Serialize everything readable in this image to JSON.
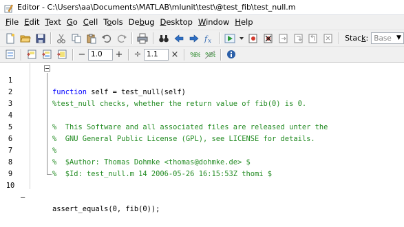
{
  "window": {
    "title": "Editor - C:\\Users\\aa\\Documents\\MATLAB\\mlunit\\test\\@test_fib\\test_null.m"
  },
  "menu": [
    {
      "mn": "F",
      "rest": "ile"
    },
    {
      "mn": "E",
      "rest": "dit"
    },
    {
      "mn": "T",
      "rest": "ext"
    },
    {
      "mn": "G",
      "rest": "o"
    },
    {
      "mn": "C",
      "rest": "ell"
    },
    {
      "pre": "T",
      "mn": "o",
      "rest": "ols"
    },
    {
      "pre": "De",
      "mn": "b",
      "rest": "ug"
    },
    {
      "mn": "D",
      "rest": "esktop"
    },
    {
      "mn": "W",
      "rest": "indow"
    },
    {
      "mn": "H",
      "rest": "elp"
    }
  ],
  "toolbar": {
    "stack_label_pre": "Stac",
    "stack_label_mn": "k",
    "stack_label_post": ":",
    "stack_value": "Base",
    "cell_minus": "−",
    "cell_value_1": "1.0",
    "cell_plus": "+",
    "cell_div": "÷",
    "cell_value_2": "1.1",
    "cell_times": "×"
  },
  "colors": {
    "keyword": "#0000ff",
    "comment": "#228b22",
    "text": "#000000"
  },
  "code": {
    "lines": [
      {
        "n": "1",
        "dash": "",
        "kw": "function",
        "text": " self = test_null(self)",
        "type": "func"
      },
      {
        "n": "2",
        "dash": "",
        "text": "%test_null checks, whether the return value of fib(0) is 0.",
        "type": "comment"
      },
      {
        "n": "3",
        "dash": "",
        "text": "",
        "type": "blank"
      },
      {
        "n": "4",
        "dash": "",
        "text": "%  This Software and all associated files are released unter the",
        "type": "comment"
      },
      {
        "n": "5",
        "dash": "",
        "text": "%  GNU General Public License (GPL), see LICENSE for details.",
        "type": "comment"
      },
      {
        "n": "6",
        "dash": "",
        "text": "%",
        "type": "comment"
      },
      {
        "n": "7",
        "dash": "",
        "text": "%  $Author: Thomas Dohmke <thomas@dohmke.de> $",
        "type": "comment"
      },
      {
        "n": "8",
        "dash": "",
        "text": "%  $Id: test_null.m 14 2006-05-26 16:15:53Z thomi $",
        "type": "comment"
      },
      {
        "n": "9",
        "dash": "",
        "text": "",
        "type": "blank"
      },
      {
        "n": "10",
        "dash": "–",
        "text": "assert_equals(0, fib(0));",
        "type": "plain"
      }
    ]
  }
}
